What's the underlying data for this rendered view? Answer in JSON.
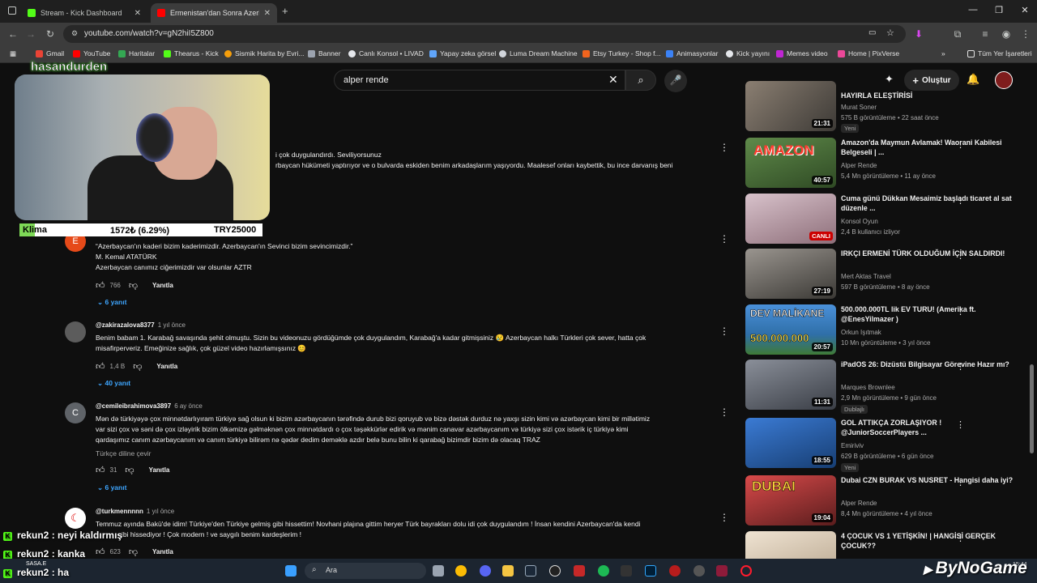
{
  "browser": {
    "tabs": [
      {
        "title": "Stream - Kick Dashboard",
        "active": false
      },
      {
        "title": "Ermenistan'dan Sonra Azerbay",
        "active": true
      }
    ],
    "new_tab": "+",
    "url": "youtube.com/watch?v=gN2hiI5Z800",
    "bookmarks": [
      "Gmail",
      "YouTube",
      "Haritalar",
      "Thearus - Kick",
      "Sismik Harita by Evri...",
      "Banner",
      "Canlı Konsol • LIVAD",
      "Yapay zeka görsel",
      "Luma Dream Machine",
      "Etsy Turkey - Shop f...",
      "Animasyonlar",
      "Kick yayını",
      "Memes video",
      "Home | PixVerse"
    ],
    "all_bookmarks": "Tüm Yer İşaretleri"
  },
  "youtube": {
    "search_value": "alper rende",
    "create_label": "Oluştur"
  },
  "comments": [
    {
      "partial_lines": [
        "i çok duygulandırdı. Seviliyorsunuz",
        "rbaycan hükümeti yaptırıyor ve o bulvarda eskiden benim arkadaşlarım yaşıyordu. Maalesef onları kaybettik, bu ince darvanış beni"
      ]
    },
    {
      "avatar_letter": "E",
      "lines": [
        "“Azerbaycan'ın kaderi bizim kaderimizdir. Azerbaycan'ın Sevinci bizim sevincimizdir.”",
        "M. Kemal ATATÜRK",
        "Azerbaycan canımız ciğerimizdir var olsunlar AZTR"
      ],
      "likes": "766",
      "reply_label": "Yanıtla",
      "replies": "6 yanıt"
    },
    {
      "username": "@zakirazalova8377",
      "time": "1 yıl önce",
      "lines": [
        "Benim babam 1. Karabağ savaşında şehit olmuştu. Sizin bu videonuzu gördüğümde çok duygulandım, Karabağ'a kadar gitmişsiniz 😢  Azerbaycan halkı Türkleri çok sever, hatta çok",
        "misafirperveriz. Emeğinize sağlık, çok güzel video hazırlamışsınız 😊"
      ],
      "likes": "1,4 B",
      "reply_label": "Yanıtla",
      "replies": "40 yanıt"
    },
    {
      "avatar_letter": "C",
      "username": "@cemileibrahimova3897",
      "time": "6 ay önce",
      "lines": [
        "Mən də türkiyəyə çox minnətdarlıyıram türkiyə sağ olsun ki bizim azərbaycanın tərəfində durub bizi qoruyub və bizə dəstək durduz nə yaxşı sizin kimi və azərbaycan kimi bir millətimiz",
        "var sizi çox və səni də çox izləyirik bizim ölkəmizə gəlməknən çox minnətdardı o çox təşəkkürlər edirik və mənim canavar azərbaycanım və türkiyə sizi çox istərik iç türkiyə kimi",
        "qardaşımız canım azərbaycanım və canım türkiyə bilirəm nə qədər dedim deməklə azdır belə bunu bilin ki qarabağ bizimdir bizim də olacaq TRAZ"
      ],
      "translate": "Türkçe diline çevir",
      "likes": "31",
      "reply_label": "Yanıtla",
      "replies": "6 yanıt"
    },
    {
      "username": "@turkmennnnn",
      "time": "1 yıl önce",
      "lines": [
        "Temmuz ayında Bakü'de idim! Türkiye'den Türkiye gelmiş gibi hissettim! Novhani plajına gittim  heryer Türk bayrakları dolu idi çok duygulandım !  İnsan kendini Azerbaycan'da kendi",
        "ibi hissediyor !  Çok modern ! ve saygılı benim kardeşlerim !"
      ],
      "likes": "623",
      "reply_label": "Yanıtla"
    }
  ],
  "recommendations": [
    {
      "title": "HAYIRLA ELEŞTİRİSİ",
      "channel": "Murat Soner",
      "meta": "575 B görüntüleme • 22 saat önce",
      "duration": "21:31",
      "badge": "Yeni",
      "thumb_color": "#8b7f72"
    },
    {
      "title": "Amazon'da Maymun Avlamak! Waorani Kabilesi Belgeseli | ...",
      "channel": "Alper Rende",
      "meta": "5,4 Mn görüntüleme • 11 ay önce",
      "duration": "40:57",
      "thumb_text": "AMAZON",
      "thumb_color": "#4f6b3a"
    },
    {
      "title": "Cuma günü Dükkan Mesaimiz başladı ticaret al sat düzenle ...",
      "channel": "Konsol Oyun",
      "meta": "2,4 B kullanıcı izliyor",
      "live": "CANLI",
      "thumb_color": "#b89aa5"
    },
    {
      "title": "IRKÇI ERMENİ TÜRK OLDUĞUM İÇİN SALDIRDI!",
      "channel": "Mert Aktas Travel",
      "meta": "597 B görüntüleme • 8 ay önce",
      "duration": "27:19",
      "thumb_color": "#6d6a66"
    },
    {
      "title": "500.000.000TL lik EV TURU! (Amerika ft. @EnesYilmazer )",
      "channel": "Orkun Işıtmak",
      "meta": "10 Mn görüntüleme • 3 yıl önce",
      "duration": "20:57",
      "thumb_text": "DEV MALİKANE",
      "thumb_text2": "500.000.000",
      "thumb_color": "#3a79b8"
    },
    {
      "title": "iPadOS 26: Dizüstü Bilgisayar Görevine Hazır mı?",
      "channel": "Marques Brownlee",
      "meta": "2,9 Mn görüntüleme • 9 gün önce",
      "duration": "11:31",
      "badge": "Dublajlı",
      "thumb_color": "#5a5f6a"
    },
    {
      "title": "GOL ATTIKÇA ZORLAŞIYOR ! @JuniorSoccerPlayers ...",
      "channel": "Emiriviv",
      "meta": "629 B görüntüleme • 6 gün önce",
      "duration": "18:55",
      "badge": "Yeni",
      "thumb_color": "#2a5e9c"
    },
    {
      "title": "Dubai CZN BURAK VS NUSRET - Hangisi daha iyi?",
      "channel": "Alper Rende",
      "meta": "8,4 Mn görüntüleme • 4 yıl önce",
      "duration": "19:04",
      "thumb_text": "DUBAI",
      "thumb_color": "#b43838"
    },
    {
      "title": "4 ÇOCUK VS 1 YETİŞKİN! | HANGİSİ GERÇEK ÇOCUK??",
      "channel": "",
      "meta": "",
      "thumb_color": "#d7c9b5"
    }
  ],
  "overlay": {
    "streamer_name": "hasandurden",
    "klima_label": "Klima",
    "klima_amount": "1572₺ (6.29%)",
    "klima_goal": "TRY25000",
    "klima_progress": 0.0629,
    "chat": [
      {
        "user": "rekun2",
        "message": ": neyi kaldırmış"
      },
      {
        "user": "rekun2",
        "message": ": kanka"
      },
      {
        "user": "rekun2",
        "message": ": ha"
      }
    ],
    "sasa_label": "SASA.E",
    "watermark": "ByNoGame"
  },
  "taskbar": {
    "search_label": "Ara",
    "time": "15:44"
  },
  "colors": {
    "accent": "#3ea6ff",
    "kick_green": "#53fc18",
    "yt_red": "#ff0000"
  }
}
